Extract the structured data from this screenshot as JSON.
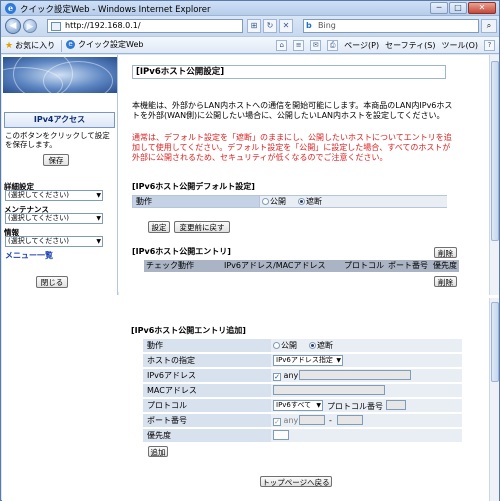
{
  "window": {
    "title": "クイック設定Web - Windows Internet Explorer",
    "url": "http://192.168.0.1/",
    "search_placeholder": "Bing",
    "controls": {
      "minimize": "─",
      "maximize": "□",
      "close": "✕"
    }
  },
  "favbar": {
    "favorites": "お気に入り",
    "tab_label": "クイック設定Web",
    "page_menu": "ページ(P)",
    "safety_menu": "セーフティ(S)",
    "tools_menu": "ツール(O)",
    "help_icon": "?"
  },
  "left": {
    "ipv4_button": "IPv4アクセス",
    "note": "このボタンをクリックして設定を保存します。",
    "save_button": "保存",
    "detail_label": "詳細設定",
    "detail_value": "(選択してください)",
    "maint_label": "メンテナンス",
    "maint_value": "(選択してください)",
    "info_label": "情報",
    "info_value": "(選択してください)",
    "menu_link": "メニュー一覧",
    "close_button": "閉じる"
  },
  "main": {
    "page_title": "[IPv6ホスト公開設定]",
    "description": "本機能は、外部からLAN内ホストへの通信を開始可能にします。本商品のLAN内IPv6ホストを外部(WAN側)に公開したい場合に、公開したいLAN内ホストを設定してください。",
    "warning": "通常は、デフォルト設定を「遮断」のままにし、公開したいホストについてエントリを追加して使用してください。デフォルト設定を「公開」に設定した場合、すべてのホストが外部に公開されるため、セキュリティが低くなるのでご注意ください。",
    "default_section": "[IPv6ホスト公開デフォルト設定]",
    "action_label": "動作",
    "open_label": "公開",
    "block_label": "遮断",
    "set_button": "設定",
    "revert_button": "変更前に戻す",
    "entry_section": "[IPv6ホスト公開エントリ]",
    "delete_button": "削除",
    "columns": [
      "チェック",
      "動作",
      "IPv6アドレス/MACアドレス",
      "プロトコル",
      "ポート番号",
      "優先度"
    ]
  },
  "add": {
    "section": "[IPv6ホスト公開エントリ追加]",
    "action_label": "動作",
    "open_label": "公開",
    "block_label": "遮断",
    "host_label": "ホストの指定",
    "host_value": "IPv6アドレス指定",
    "ipv6_label": "IPv6アドレス",
    "any_label": "any",
    "mac_label": "MACアドレス",
    "protocol_label": "プロトコル",
    "protocol_value": "IPv6すべて",
    "protocol_number_label": "プロトコル番号",
    "port_label": "ポート番号",
    "port_dash": "-",
    "priority_label": "優先度",
    "add_button": "追加",
    "top_button": "トップページへ戻る"
  }
}
